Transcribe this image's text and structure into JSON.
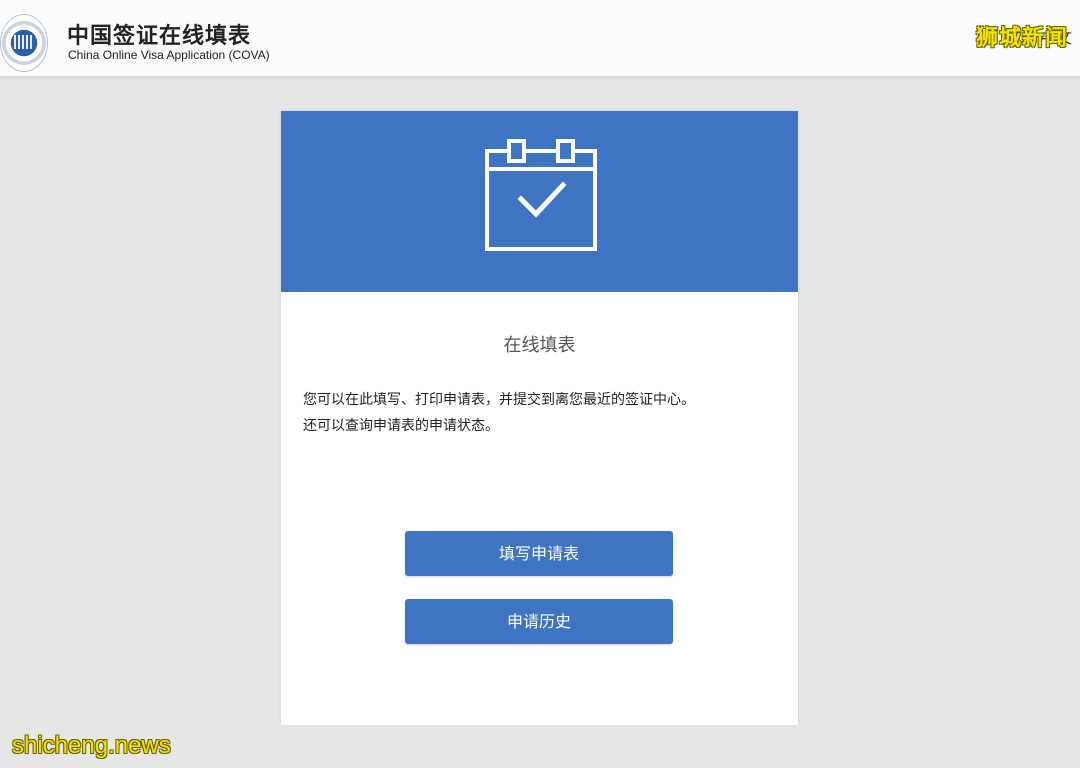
{
  "header": {
    "title": "中国签证在线填表",
    "subtitle": "China Online Visa Application (COVA)",
    "lang_toggle": "中文",
    "logo_icon": "government-seal-logo"
  },
  "watermarks": {
    "top_right": "狮城新闻",
    "bottom_left": "shicheng.news"
  },
  "card": {
    "banner_icon": "calendar-check-icon",
    "title": "在线填表",
    "description_lines": [
      "您可以在此填写、打印申请表，并提交到离您最近的签证中心。",
      "还可以查询申请表的申请状态。"
    ],
    "buttons": {
      "fill_application": "填写申请表",
      "application_history": "申请历史"
    }
  },
  "colors": {
    "primary_blue": "#3f74c3",
    "page_background": "#e6e6e6",
    "header_background": "#fbfbfb",
    "watermark_yellow": "#f2e300"
  }
}
